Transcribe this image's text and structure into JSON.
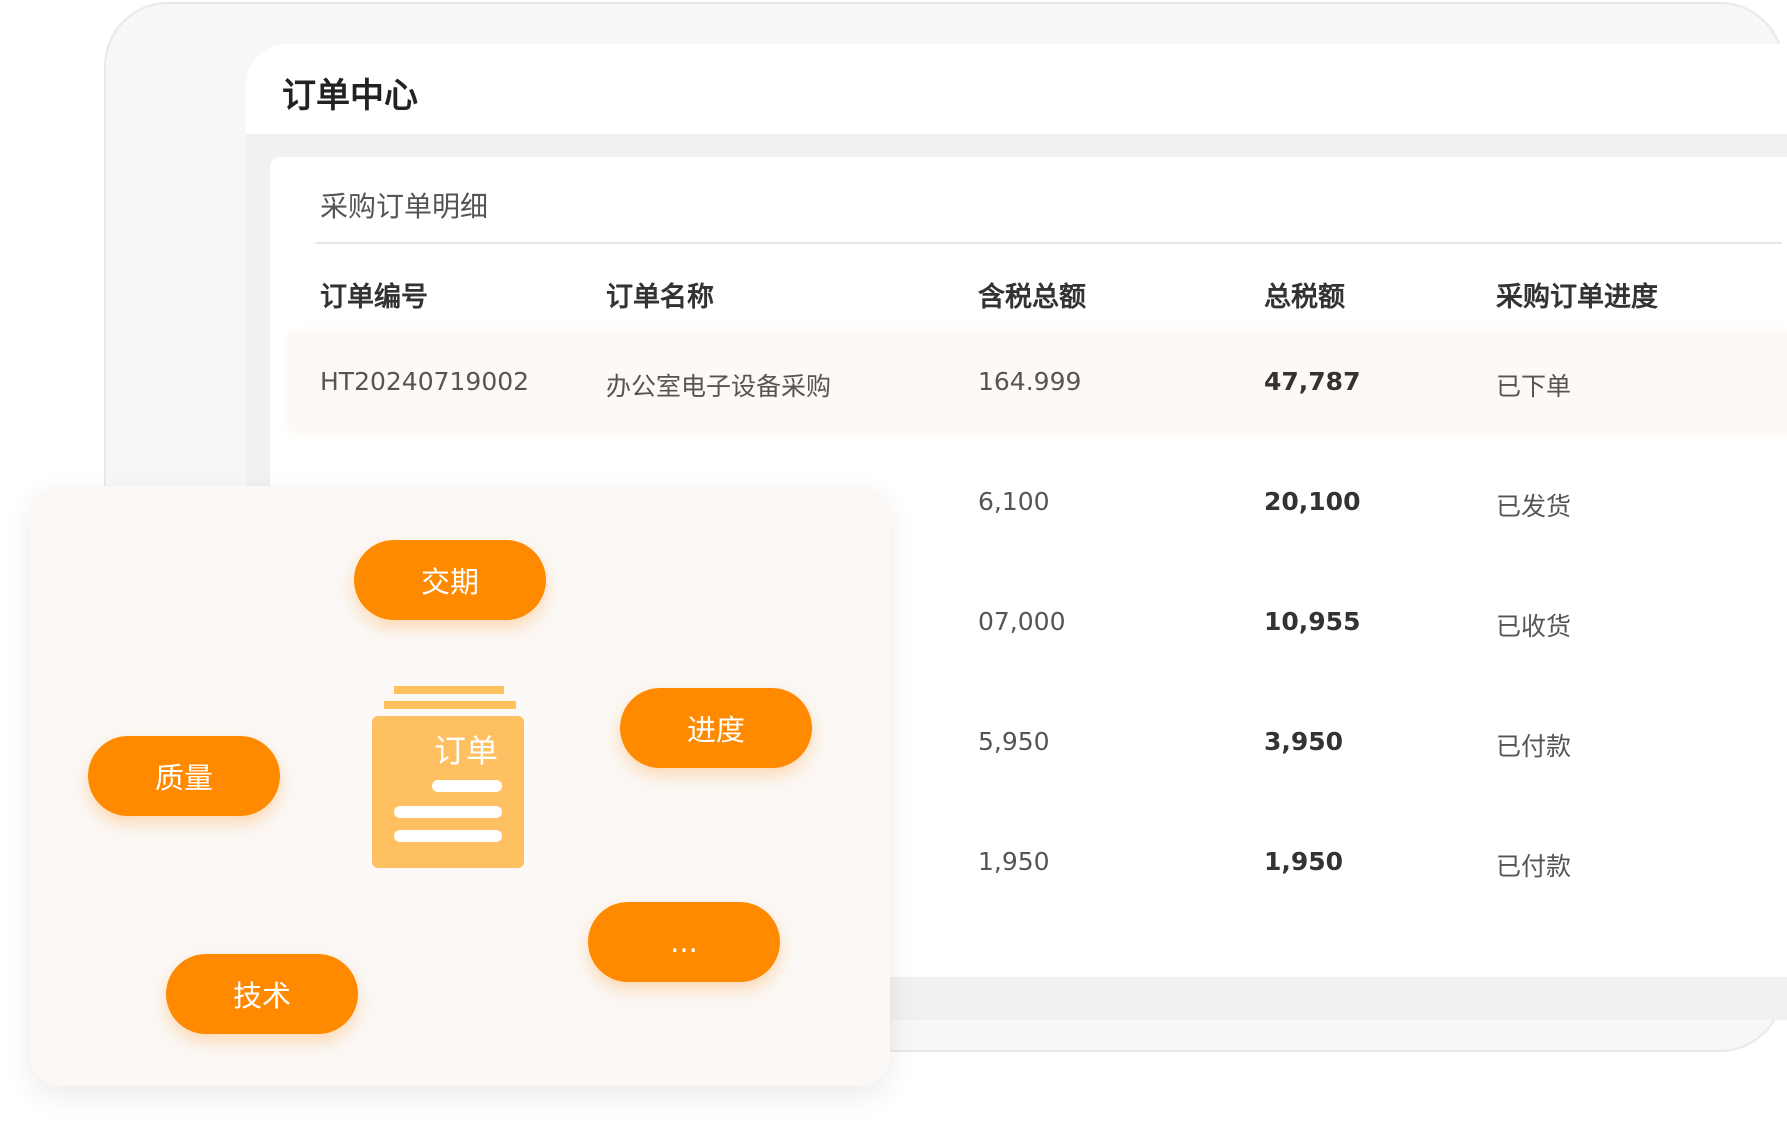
{
  "app": {
    "title": "订单中心"
  },
  "section": {
    "title": "采购订单明细"
  },
  "table": {
    "headers": [
      "订单编号",
      "订单名称",
      "含税总额",
      "总税额",
      "采购订单进度"
    ],
    "rows": [
      {
        "order_no": "HT20240719002",
        "order_name": "办公室电子设备采购",
        "gross": "164.999",
        "tax": "47,787",
        "status": "已下单"
      },
      {
        "order_no": "",
        "order_name": "",
        "gross": "6,100",
        "tax": "20,100",
        "status": "已发货"
      },
      {
        "order_no": "",
        "order_name": "",
        "gross": "07,000",
        "tax": "10,955",
        "status": "已收货"
      },
      {
        "order_no": "",
        "order_name": "",
        "gross": "5,950",
        "tax": "3,950",
        "status": "已付款"
      },
      {
        "order_no": "",
        "order_name": "",
        "gross": "1,950",
        "tax": "1,950",
        "status": "已付款"
      }
    ]
  },
  "overlay": {
    "doc_label": "订单",
    "tags": [
      "交期",
      "进度",
      "质量",
      "技术",
      "..."
    ]
  },
  "colors": {
    "accent": "#ff8a00",
    "doc": "#ffc062",
    "row_highlight": "#fef9f4"
  },
  "icons": [
    "order-document-icon"
  ]
}
